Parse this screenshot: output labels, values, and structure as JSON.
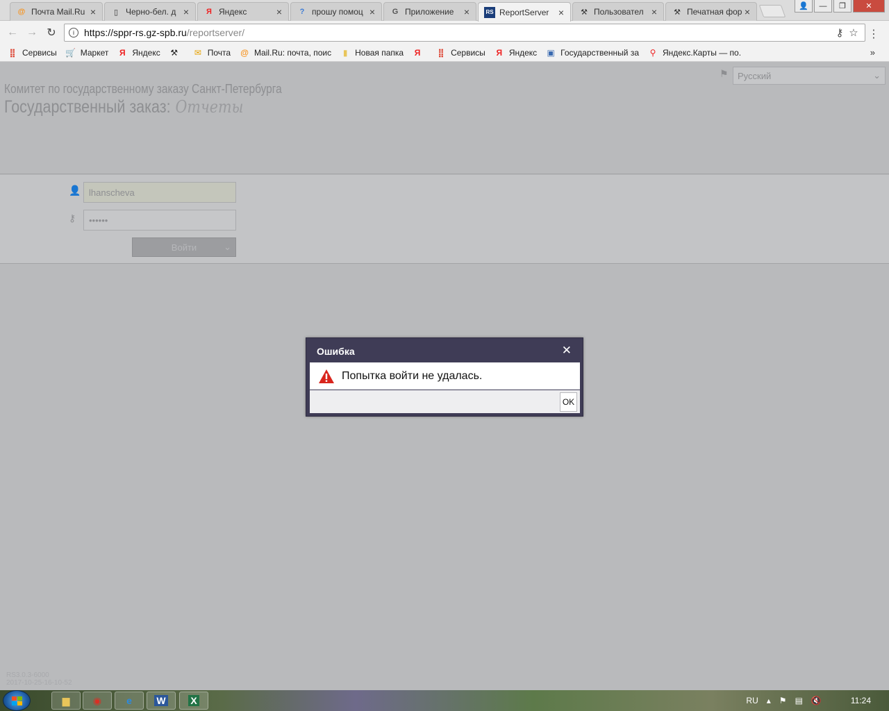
{
  "browser": {
    "tabs": [
      {
        "title": "Почта Mail.Ru",
        "icon": "mailru-icon"
      },
      {
        "title": "Черно-бел. д",
        "icon": "document-icon"
      },
      {
        "title": "Яндекс",
        "icon": "yandex-icon"
      },
      {
        "title": "прошу помоц",
        "icon": "question-icon"
      },
      {
        "title": "Приложение",
        "icon": "google-icon"
      },
      {
        "title": "ReportServer",
        "icon": "reportserver-icon",
        "active": true
      },
      {
        "title": "Пользовател",
        "icon": "tools-icon"
      },
      {
        "title": "Печатная фор",
        "icon": "tools-icon"
      }
    ],
    "url_host": "https://sppr-rs.gz-spb.ru",
    "url_path": "/reportserver/",
    "bookmarks": [
      {
        "label": "Сервисы",
        "icon": "apps-grid-icon"
      },
      {
        "label": "Маркет",
        "icon": "cart-icon"
      },
      {
        "label": "Яндекс",
        "icon": "yandex-icon"
      },
      {
        "label": "",
        "icon": "tools-icon"
      },
      {
        "label": "Почта",
        "icon": "mail-icon"
      },
      {
        "label": "Mail.Ru: почта, поис",
        "icon": "mailru-icon"
      },
      {
        "label": "Новая папка",
        "icon": "folder-icon"
      },
      {
        "label": "",
        "icon": "yandex-bookmark-icon"
      },
      {
        "label": "Сервисы",
        "icon": "apps-grid-icon"
      },
      {
        "label": "Яндекс",
        "icon": "yandex-icon"
      },
      {
        "label": "Государственный за",
        "icon": "building-icon"
      },
      {
        "label": "Яндекс.Карты — по.",
        "icon": "map-pin-icon"
      }
    ],
    "more": "»"
  },
  "page": {
    "org_name": "Комитет по государственному заказу Санкт-Петербурга",
    "product_name": "Государственный заказ:",
    "product_suffix": "Отчеты",
    "language": "Русский",
    "username": "lhanscheva",
    "password_mask": "••••••",
    "login_button": "Войти",
    "version_line1": "RS3.0.3-6000",
    "version_line2": "2017-10-25-16-10-52"
  },
  "dialog": {
    "title": "Ошибка",
    "message": "Попытка войти не удалась.",
    "ok": "OK",
    "close": "✕"
  },
  "taskbar": {
    "lang": "RU",
    "time": "11:24"
  },
  "colors": {
    "dialog_header": "#3f3c56",
    "overlay": "#b9babc",
    "warning": "#d9251d"
  }
}
